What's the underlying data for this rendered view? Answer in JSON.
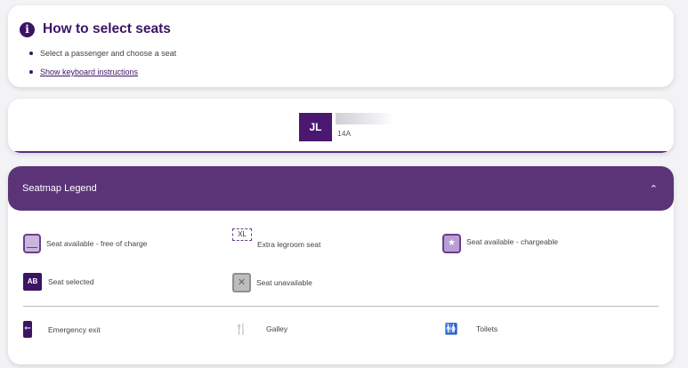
{
  "how_to": {
    "title": "How to select seats",
    "steps": [
      "Select a passenger and choose a seat",
      "Show keyboard instructions"
    ]
  },
  "passenger": {
    "initials": "JL",
    "seat": "14A"
  },
  "legend": {
    "title": "Seatmap Legend",
    "items": {
      "free": "Seat available - free of charge",
      "xl_label": "XL",
      "xl": "Extra legroom seat",
      "chargeable": "Seat available - chargeable",
      "selected_label": "AB",
      "selected": "Seat selected",
      "unavailable": "Seat unavailable",
      "exit": "Emergency exit",
      "galley": "Galley",
      "toilets": "Toilets"
    }
  },
  "colors": {
    "brand_dark": "#3b1464",
    "legend_header": "#5b3478"
  },
  "icons": {
    "info": "info-icon",
    "chevron": "chevron-up-icon",
    "exit": "emergency-exit-icon",
    "galley": "galley-icon",
    "toilets": "toilets-icon"
  }
}
